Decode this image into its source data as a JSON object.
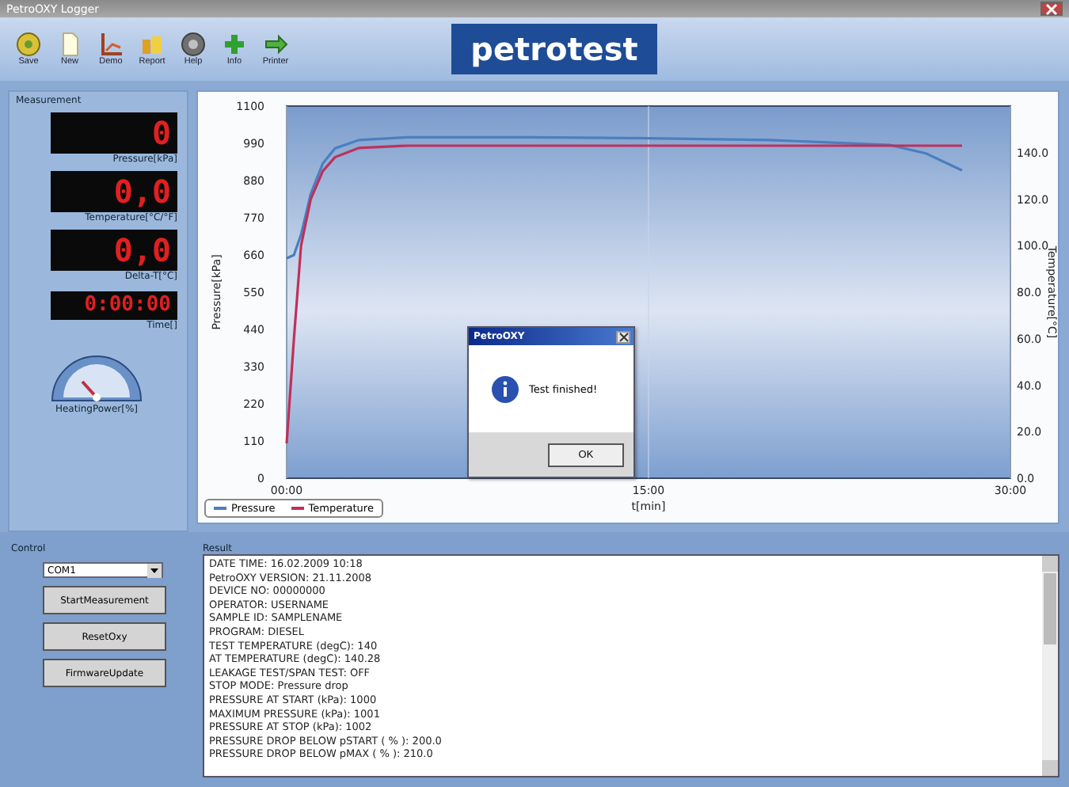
{
  "window": {
    "title": "PetroOXY Logger"
  },
  "toolbar": [
    {
      "label": "Save",
      "kind": "save"
    },
    {
      "label": "New",
      "kind": "new"
    },
    {
      "label": "Demo",
      "kind": "demo"
    },
    {
      "label": "Report",
      "kind": "report"
    },
    {
      "label": "Help",
      "kind": "help"
    },
    {
      "label": "Info",
      "kind": "info"
    },
    {
      "label": "Printer",
      "kind": "printer"
    }
  ],
  "logo": "petrotest",
  "measurement": {
    "title": "Measurement",
    "displays": [
      {
        "value": "0",
        "label": "Pressure[kPa]"
      },
      {
        "value": "0,0",
        "label": "Temperature[°C/°F]"
      },
      {
        "value": "0,0",
        "label": "Delta-T[°C]"
      },
      {
        "value": "0:00:00",
        "label": "Time[]"
      }
    ],
    "gauge_label": "HeatingPower[%]"
  },
  "chart": {
    "chart_data": {
      "type": "line",
      "legend": "bottom-left",
      "xlabel": "t[min]",
      "ylabel": "Pressure[kPa]",
      "y2label": "Temperature[°C]",
      "x": [
        0,
        0.3,
        0.6,
        1,
        1.5,
        2,
        3,
        5,
        10,
        15,
        20,
        25,
        26.5,
        28
      ],
      "xlim": [
        0,
        30
      ],
      "ylim": [
        0,
        1100
      ],
      "y2lim": [
        0,
        160
      ],
      "xticks": [
        {
          "value": 0,
          "label": "00:00"
        },
        {
          "value": 15,
          "label": "15:00"
        },
        {
          "value": 30,
          "label": "30:00"
        }
      ],
      "yticks": [
        {
          "value": 0,
          "label": "0"
        },
        {
          "value": 110,
          "label": "110"
        },
        {
          "value": 220,
          "label": "220"
        },
        {
          "value": 330,
          "label": "330"
        },
        {
          "value": 440,
          "label": "440"
        },
        {
          "value": 550,
          "label": "550"
        },
        {
          "value": 660,
          "label": "660"
        },
        {
          "value": 770,
          "label": "770"
        },
        {
          "value": 880,
          "label": "880"
        },
        {
          "value": 990,
          "label": "990"
        },
        {
          "value": 1100,
          "label": "1100"
        }
      ],
      "y2ticks": [
        {
          "value": 0,
          "label": "0.0"
        },
        {
          "value": 20,
          "label": "20.0"
        },
        {
          "value": 40,
          "label": "40.0"
        },
        {
          "value": 60,
          "label": "60.0"
        },
        {
          "value": 80,
          "label": "80.0"
        },
        {
          "value": 100,
          "label": "100.0"
        },
        {
          "value": 120,
          "label": "120.0"
        },
        {
          "value": 140,
          "label": "140.0"
        }
      ],
      "series": [
        {
          "name": "Pressure",
          "color": "#4a7fc0",
          "values": [
            650,
            660,
            720,
            840,
            930,
            975,
            1000,
            1008,
            1008,
            1005,
            1000,
            985,
            960,
            910
          ]
        },
        {
          "name": "Temperature",
          "color": "#c0305a",
          "axis": "y2",
          "values": [
            15,
            60,
            100,
            120,
            132,
            138,
            142,
            143,
            143,
            143,
            143,
            143,
            143,
            143
          ]
        }
      ]
    }
  },
  "dialog": {
    "title": "PetroOXY",
    "message": "Test finished!",
    "button": "OK"
  },
  "control": {
    "title": "Control",
    "port": "COM1",
    "buttons": [
      "StartMeasurement",
      "ResetOxy",
      "FirmwareUpdate"
    ]
  },
  "result": {
    "title": "Result",
    "lines": [
      "DATE TIME: 16.02.2009 10:18",
      "PetroOXY VERSION: 21.11.2008",
      "DEVICE NO: 00000000",
      "OPERATOR: USERNAME",
      "SAMPLE ID: SAMPLENAME",
      "PROGRAM: DIESEL",
      "TEST TEMPERATURE (degC): 140",
      "AT TEMPERATURE (degC): 140.28",
      "LEAKAGE TEST/SPAN TEST: OFF",
      "STOP MODE: Pressure drop",
      "PRESSURE AT START (kPa): 1000",
      "MAXIMUM PRESSURE (kPa): 1001",
      "PRESSURE AT STOP (kPa): 1002",
      "PRESSURE DROP BELOW pSTART ( % ): 200.0",
      "PRESSURE DROP BELOW pMAX ( % ): 210.0"
    ]
  }
}
